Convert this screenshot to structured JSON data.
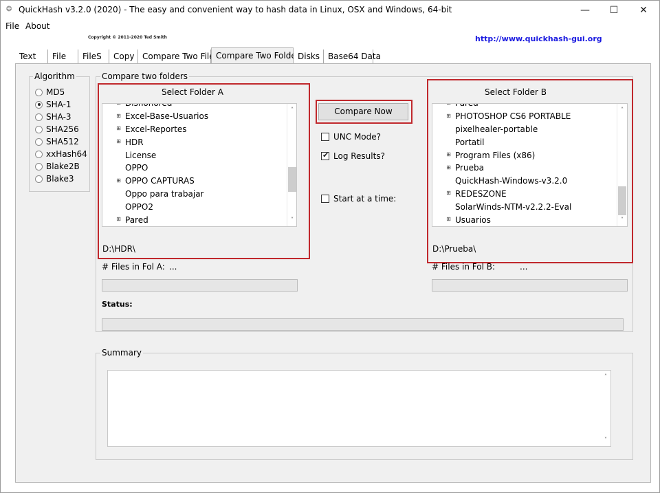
{
  "window": {
    "title": "QuickHash v3.2.0 (2020) - The easy and convenient way to hash data in Linux, OSX and Windows, 64-bit",
    "minimize": "—",
    "maximize": "☐",
    "close": "✕"
  },
  "menu": [
    "File",
    "About"
  ],
  "copyright": "Copyright © 2011-2020  Ted Smith",
  "website": "http://www.quickhash-gui.org",
  "tabs": [
    {
      "label": "Text",
      "active": false
    },
    {
      "label": "File",
      "active": false
    },
    {
      "label": "FileS",
      "active": false
    },
    {
      "label": "Copy",
      "active": false
    },
    {
      "label": "Compare Two Files",
      "active": false
    },
    {
      "label": "Compare Two Folders",
      "active": true
    },
    {
      "label": "Disks",
      "active": false
    },
    {
      "label": "Base64 Data",
      "active": false
    }
  ],
  "algorithm": {
    "caption": "Algorithm",
    "options": [
      {
        "label": "MD5",
        "checked": false
      },
      {
        "label": "SHA-1",
        "checked": true
      },
      {
        "label": "SHA-3",
        "checked": false
      },
      {
        "label": "SHA256",
        "checked": false
      },
      {
        "label": "SHA512",
        "checked": false
      },
      {
        "label": "xxHash64",
        "checked": false
      },
      {
        "label": "Blake2B",
        "checked": false
      },
      {
        "label": "Blake3",
        "checked": false
      }
    ]
  },
  "compare": {
    "caption": "Compare two folders",
    "folder_a": {
      "header": "Select Folder A",
      "path": "D:\\HDR\\",
      "files_label": "# Files in Fol A:",
      "files_value": "...",
      "items": [
        {
          "label": "Dishonored",
          "expandable": true
        },
        {
          "label": "Excel-Base-Usuarios",
          "expandable": true
        },
        {
          "label": "Excel-Reportes",
          "expandable": true
        },
        {
          "label": "HDR",
          "expandable": true
        },
        {
          "label": "License",
          "expandable": false
        },
        {
          "label": "OPPO",
          "expandable": false
        },
        {
          "label": "OPPO CAPTURAS",
          "expandable": true
        },
        {
          "label": "Oppo para trabajar",
          "expandable": false
        },
        {
          "label": "OPPO2",
          "expandable": false
        },
        {
          "label": "Pared",
          "expandable": true
        }
      ]
    },
    "folder_b": {
      "header": "Select Folder B",
      "path": "D:\\Prueba\\",
      "files_label": "# Files in Fol B:",
      "files_value": "...",
      "items": [
        {
          "label": "Pared",
          "expandable": true
        },
        {
          "label": "PHOTOSHOP CS6 PORTABLE",
          "expandable": true
        },
        {
          "label": "pixelhealer-portable",
          "expandable": false
        },
        {
          "label": "Portatil",
          "expandable": false
        },
        {
          "label": "Program Files (x86)",
          "expandable": true
        },
        {
          "label": "Prueba",
          "expandable": true
        },
        {
          "label": "QuickHash-Windows-v3.2.0",
          "expandable": false
        },
        {
          "label": "REDESZONE",
          "expandable": true
        },
        {
          "label": "SolarWinds-NTM-v2.2.2-Eval",
          "expandable": false
        },
        {
          "label": "Usuarios",
          "expandable": true
        }
      ]
    },
    "compare_button": "Compare Now",
    "unc_mode": {
      "label": "UNC Mode?",
      "checked": false
    },
    "log_results": {
      "label": "Log Results?",
      "checked": true
    },
    "start_at": {
      "label": "Start at a time:",
      "checked": false
    },
    "status_label": "Status:"
  },
  "summary": {
    "caption": "Summary"
  },
  "icons": {
    "expand": "⊞",
    "scroll_up": "˄",
    "scroll_down": "˅"
  }
}
